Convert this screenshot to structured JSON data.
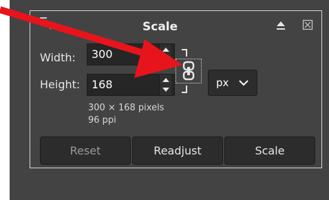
{
  "dialog": {
    "title": "Scale",
    "icons": {
      "corner": "resize-corner-icon",
      "up": "eject-up-icon",
      "close": "close-box-icon",
      "chain": "chain-link-icon",
      "dropdown": "chevron-down-icon",
      "annotation": "red-arrow-icon"
    }
  },
  "width": {
    "label": "Width:",
    "value": "300"
  },
  "height": {
    "label": "Height:",
    "value": "168"
  },
  "unit": {
    "value": "px"
  },
  "info": {
    "size": "300 × 168 pixels",
    "resolution": "96 ppi"
  },
  "buttons": {
    "reset": "Reset",
    "readjust": "Readjust",
    "scale": "Scale"
  },
  "colors": {
    "panel": "#434343",
    "field": "#262626",
    "annotation": "#e8141c"
  }
}
